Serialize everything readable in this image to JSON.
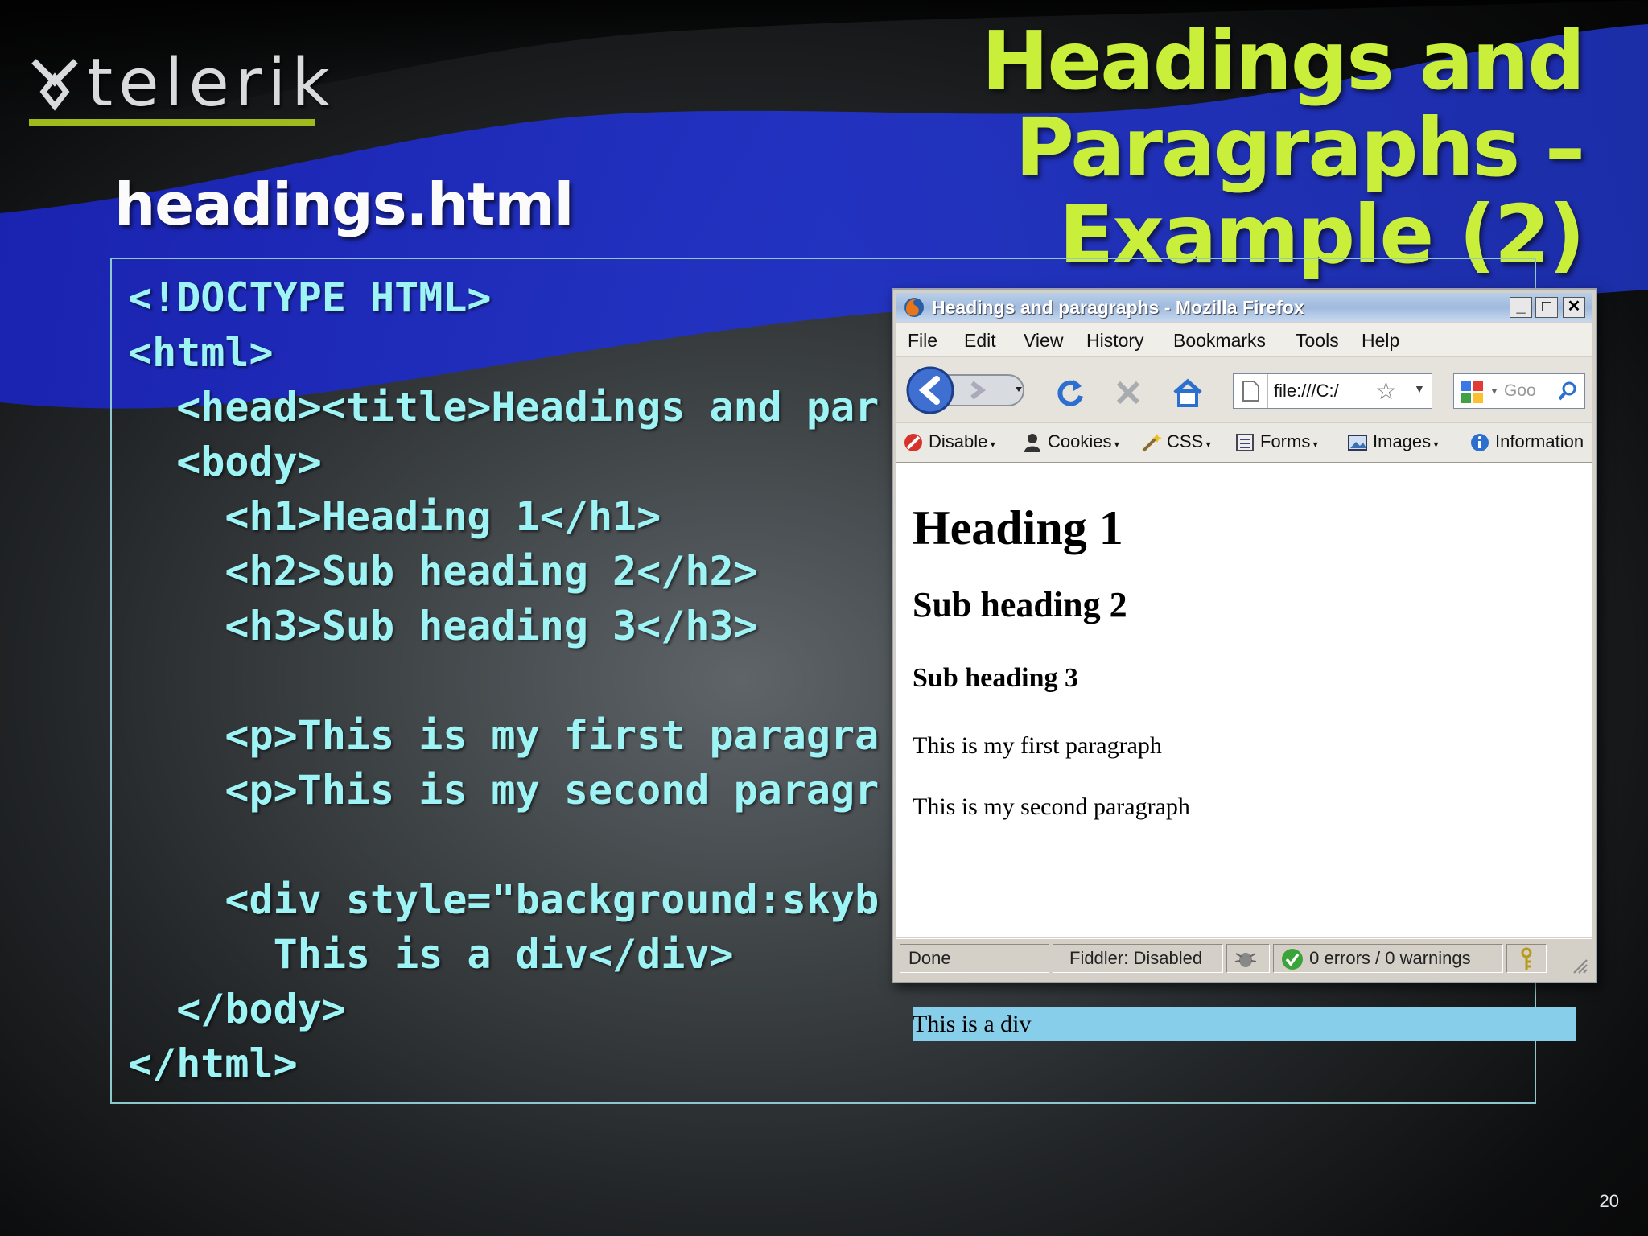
{
  "slide": {
    "logo_text": "telerik",
    "title_line1": "Headings and Paragraphs –",
    "title_line2": "Example (2)",
    "file_name": "headings.html",
    "page_number": "20",
    "code_lines": [
      "<!DOCTYPE HTML>",
      "<html>",
      "  <head><title>Headings and par",
      "  <body>",
      "    <h1>Heading 1</h1>",
      "    <h2>Sub heading 2</h2>",
      "    <h3>Sub heading 3</h3>",
      "",
      "    <p>This is my first paragra",
      "    <p>This is my second paragr",
      "",
      "    <div style=\"background:skyb",
      "      This is a div</div>",
      "  </body>",
      "</html>"
    ]
  },
  "browser": {
    "window_title": "Headings and paragraphs - Mozilla Firefox",
    "menu": [
      "File",
      "Edit",
      "View",
      "History",
      "Bookmarks",
      "Tools",
      "Help"
    ],
    "address": "file:///C:/",
    "search_placeholder": "Goo",
    "toolbar": [
      "Disable",
      "Cookies",
      "CSS",
      "Forms",
      "Images",
      "Information"
    ],
    "content": {
      "h1": "Heading 1",
      "h2": "Sub heading 2",
      "h3": "Sub heading 3",
      "p1": "This is my first paragraph",
      "p2": "This is my second paragraph",
      "div": "This is a div",
      "div_background": "#87ceeb"
    },
    "status": {
      "done": "Done",
      "fiddler": "Fiddler: Disabled",
      "errors": "0 errors / 0 warnings"
    }
  },
  "colors": {
    "title": "#c9ef3a",
    "code": "#9ef4f4",
    "logo_bar": "#9fba1c",
    "wave": "#1a2fbf"
  }
}
